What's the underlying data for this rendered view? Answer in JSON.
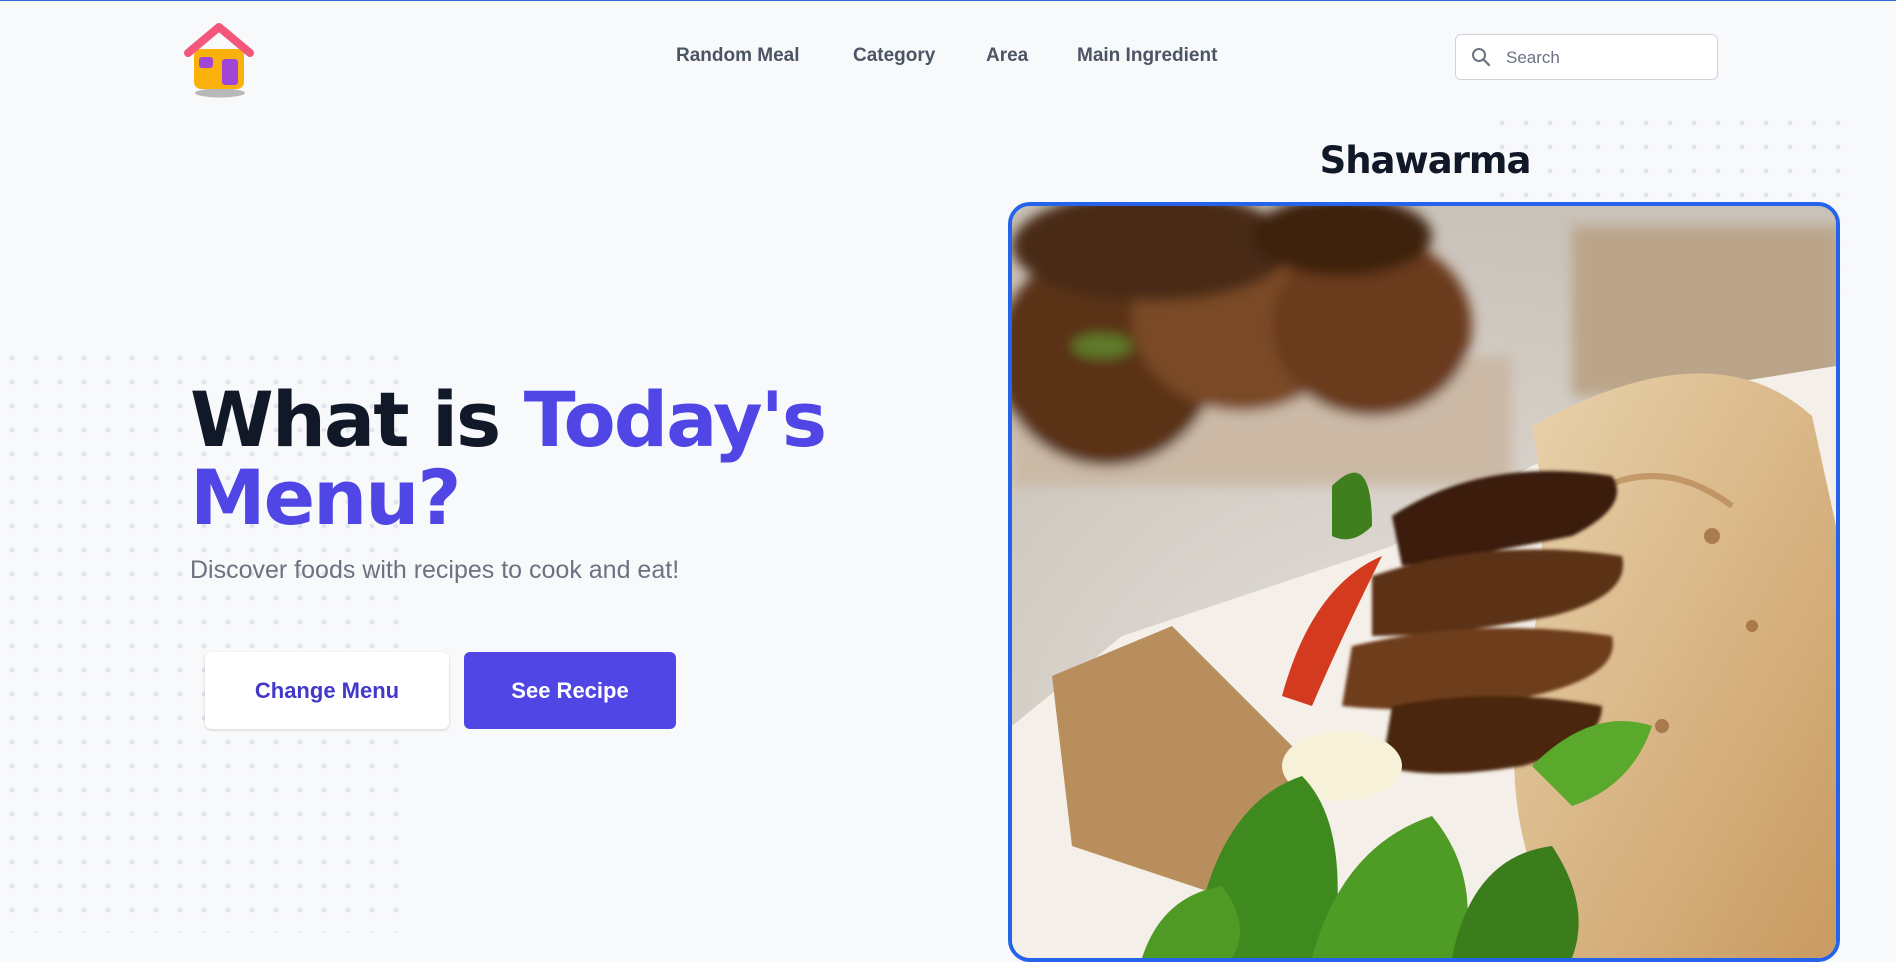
{
  "header": {
    "logo": "house-logo",
    "nav": [
      {
        "label": "Random Meal"
      },
      {
        "label": "Category"
      },
      {
        "label": "Area"
      },
      {
        "label": "Main Ingredient"
      }
    ],
    "search": {
      "placeholder": "Search",
      "value": ""
    }
  },
  "hero": {
    "title_part1": "What is ",
    "title_accent_1": "Today's",
    "title_accent_2": "Menu?",
    "subtitle": "Discover foods with recipes to cook and eat!",
    "buttons": {
      "change_menu": "Change Menu",
      "see_recipe": "See Recipe"
    }
  },
  "meal": {
    "name": "Shawarma",
    "image_alt": "Shawarma"
  },
  "colors": {
    "accent": "#4f46e5",
    "accent_dark": "#4338ca",
    "image_border": "#2563eb",
    "text_dark": "#111827",
    "text_muted": "#6b7280",
    "background": "#f8f9fb"
  }
}
